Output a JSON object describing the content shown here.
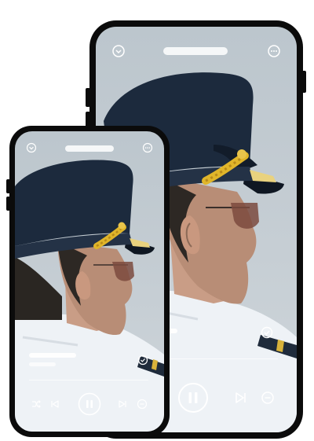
{
  "app": {
    "title": "",
    "icons": {
      "collapse": "chevron-down-circle-icon",
      "more": "more-horizontal-circle-icon",
      "shuffle": "shuffle-icon",
      "previous": "skip-previous-icon",
      "pause": "pause-icon",
      "next": "skip-next-icon",
      "remove": "minus-circle-icon",
      "check": "check-circle-icon"
    },
    "colors": {
      "phone_frame": "#0b0b0b",
      "sky": "#c3ccd2",
      "cap": "#1c2a3d",
      "braid": "#e0b52a",
      "shirt": "#f1f4f7",
      "control": "#ffffff"
    }
  },
  "large_phone": {
    "track_progress": 0.05
  },
  "small_phone": {
    "track_progress": 0.0
  }
}
